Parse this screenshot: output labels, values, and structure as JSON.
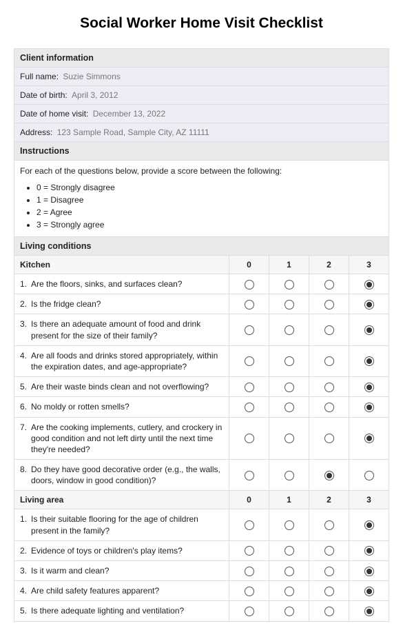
{
  "title": "Social Worker Home Visit Checklist",
  "client_section_header": "Client information",
  "client": {
    "full_name_label": "Full name:",
    "full_name": "Suzie Simmons",
    "dob_label": "Date of birth:",
    "dob": "April 3, 2012",
    "visit_label": "Date of home visit:",
    "visit": "December 13, 2022",
    "address_label": "Address:",
    "address": "123 Sample Road, Sample City, AZ 11111"
  },
  "instructions_header": "Instructions",
  "instructions_intro": "For each of the questions below, provide a score between the following:",
  "scale": [
    "0 = Strongly disagree",
    "1 = Disagree",
    "2 = Agree",
    "3 = Strongly agree"
  ],
  "living_header": "Living conditions",
  "score_labels": [
    "0",
    "1",
    "2",
    "3"
  ],
  "kitchen_header": "Kitchen",
  "kitchen": [
    {
      "n": "1.",
      "q": "Are the floors, sinks, and surfaces clean?",
      "sel": 3
    },
    {
      "n": "2.",
      "q": "Is the fridge clean?",
      "sel": 3
    },
    {
      "n": "3.",
      "q": "Is there an adequate amount of food and drink present for the size of their family?",
      "sel": 3
    },
    {
      "n": "4.",
      "q": "Are all foods and drinks stored appropriately, within the expiration dates, and age-appropriate?",
      "sel": 3
    },
    {
      "n": "5.",
      "q": "Are their waste binds clean and not overflowing?",
      "sel": 3
    },
    {
      "n": "6.",
      "q": "No moldy or rotten smells?",
      "sel": 3
    },
    {
      "n": "7.",
      "q": "Are the cooking implements, cutlery, and crockery in good condition and not left dirty until the next time they're needed?",
      "sel": 3
    },
    {
      "n": "8.",
      "q": "Do they have good decorative order (e.g., the walls, doors, window in good condition)?",
      "sel": 2
    }
  ],
  "living_area_header": "Living area",
  "living_area": [
    {
      "n": "1.",
      "q": "Is their suitable flooring for the age of children present in the family?",
      "sel": 3
    },
    {
      "n": "2.",
      "q": "Evidence of toys or children's play items?",
      "sel": 3
    },
    {
      "n": "3.",
      "q": "Is it warm and clean?",
      "sel": 3
    },
    {
      "n": "4.",
      "q": "Are child safety features apparent?",
      "sel": 3
    },
    {
      "n": "5.",
      "q": "Is there adequate lighting and ventilation?",
      "sel": 3
    }
  ]
}
